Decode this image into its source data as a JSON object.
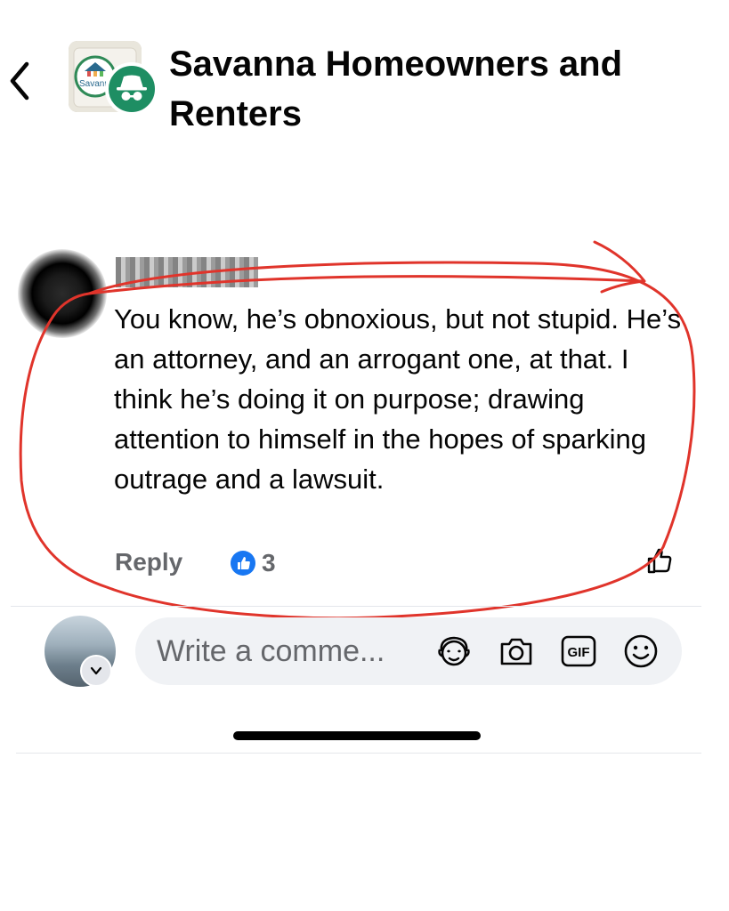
{
  "header": {
    "group_name": "Savanna Homeowners and Renters",
    "group_logo_text": "Savann Unite"
  },
  "comment": {
    "text": "You know, he’s obnoxious, but not stupid.  He’s an attorney, and an arrogant one, at that.  I think he’s doing it on purpose; drawing attention to himself in the hopes of sparking outrage and a lawsuit.",
    "reply_label": "Reply",
    "reaction_count": "3",
    "reaction_type": "like"
  },
  "composer": {
    "placeholder": "Write a comme...",
    "gif_label": "GIF"
  },
  "colors": {
    "accent_blue": "#1877f2",
    "annotation_red": "#e0342b",
    "anon_badge_green": "#1e8e63",
    "secondary_text": "#65676b"
  },
  "icons": [
    "back-arrow-icon",
    "anonymous-participant-icon",
    "like-icon",
    "thumbs-up-outline-icon",
    "chevron-down-icon",
    "avatar-sticker-icon",
    "camera-icon",
    "gif-icon",
    "emoji-icon"
  ]
}
